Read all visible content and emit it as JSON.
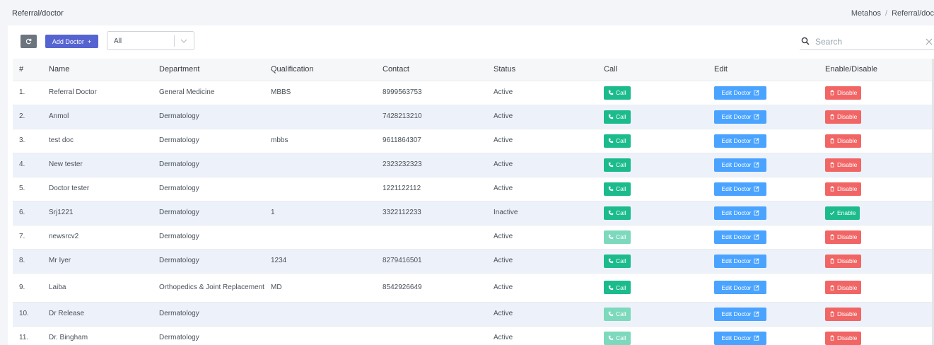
{
  "header": {
    "title": "Referral/doctor",
    "breadcrumb": [
      "Metahos",
      "Referral/doc"
    ],
    "breadcrumb_sep": "/"
  },
  "toolbar": {
    "refresh_icon": "refresh-icon",
    "add_label": "Add Doctor",
    "add_plus": "+",
    "filter_value": "All",
    "search_placeholder": "Search"
  },
  "colors": {
    "call": "#1cbb8c",
    "edit": "#4aa3ff",
    "disable": "#f16565",
    "add": "#5664d2"
  },
  "table": {
    "columns": [
      "#",
      "Name",
      "Department",
      "Qualification",
      "Contact",
      "Status",
      "Call",
      "Edit",
      "Enable/Disable"
    ],
    "call_label": "Call",
    "edit_label": "Edit Doctor",
    "disable_label": "Disable",
    "enable_label": "Enable",
    "rows": [
      {
        "num": "1.",
        "name": "Referral Doctor",
        "dept": "General Medicine",
        "qual": "MBBS",
        "contact": "8999563753",
        "status": "Active",
        "call_enabled": true,
        "action": "disable"
      },
      {
        "num": "2.",
        "name": "Anmol",
        "dept": "Dermatology",
        "qual": "",
        "contact": "7428213210",
        "status": "Active",
        "call_enabled": true,
        "action": "disable"
      },
      {
        "num": "3.",
        "name": "test doc",
        "dept": "Dermatology",
        "qual": "mbbs",
        "contact": "9611864307",
        "status": "Active",
        "call_enabled": true,
        "action": "disable"
      },
      {
        "num": "4.",
        "name": "New tester",
        "dept": "Dermatology",
        "qual": "",
        "contact": "2323232323",
        "status": "Active",
        "call_enabled": true,
        "action": "disable"
      },
      {
        "num": "5.",
        "name": "Doctor tester",
        "dept": "Dermatology",
        "qual": "",
        "contact": "1221122112",
        "status": "Active",
        "call_enabled": true,
        "action": "disable"
      },
      {
        "num": "6.",
        "name": "Srj1221",
        "dept": "Dermatology",
        "qual": "1",
        "contact": "3322112233",
        "status": "Inactive",
        "call_enabled": true,
        "action": "enable"
      },
      {
        "num": "7.",
        "name": "newsrcv2",
        "dept": "Dermatology",
        "qual": "",
        "contact": "",
        "status": "Active",
        "call_enabled": false,
        "action": "disable"
      },
      {
        "num": "8.",
        "name": "Mr Iyer",
        "dept": "Dermatology",
        "qual": "1234",
        "contact": "8279416501",
        "status": "Active",
        "call_enabled": true,
        "action": "disable"
      },
      {
        "num": "9.",
        "name": "Laiba",
        "dept": "Orthopedics & Joint Replacement",
        "qual": "MD",
        "contact": "8542926649",
        "status": "Active",
        "call_enabled": true,
        "action": "disable"
      },
      {
        "num": "10.",
        "name": "Dr Release",
        "dept": "Dermatology",
        "qual": "",
        "contact": "",
        "status": "Active",
        "call_enabled": false,
        "action": "disable"
      },
      {
        "num": "11.",
        "name": "Dr. Bingham",
        "dept": "Dermatology",
        "qual": "",
        "contact": "",
        "status": "Active",
        "call_enabled": false,
        "action": "disable"
      }
    ]
  }
}
